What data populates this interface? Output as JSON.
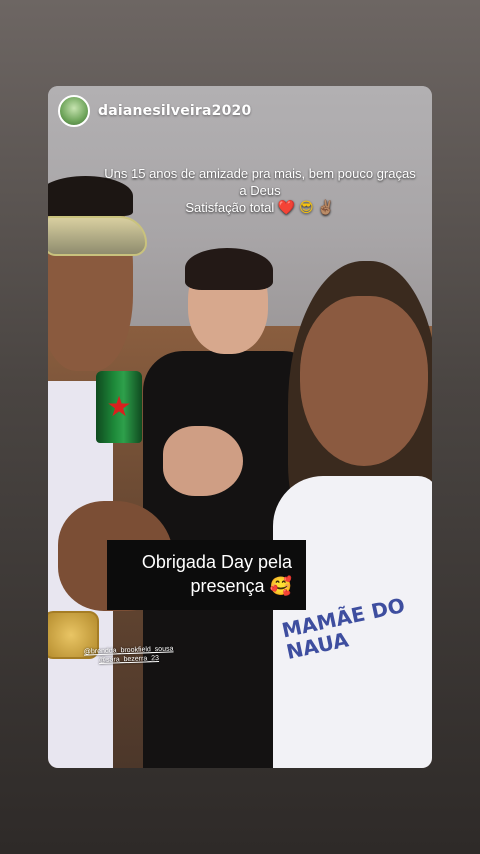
{
  "story": {
    "username": "daianesilveira2020",
    "caption_line1": "Uns 15 anos de amizade pra mais, bem pouco graças a Deus",
    "caption_line2": "Satisfação total",
    "caption_emojis": [
      "❤️",
      "😎",
      "✌🏽"
    ],
    "sticker_line1": "Obrigada Day pela",
    "sticker_line2": "presença",
    "sticker_emoji": "🥰",
    "mention1": "@brendda_brookfield_sousa",
    "mention2": "@sara_bezerra_23",
    "shirt_text": "MAMÃE DO NAUA"
  },
  "icons": {
    "avatar": "profile-avatar",
    "beer_logo": "red-star-icon"
  },
  "colors": {
    "background": "#4a4542",
    "sticker_bg": "#0c0c0c",
    "text": "#ffffff"
  }
}
